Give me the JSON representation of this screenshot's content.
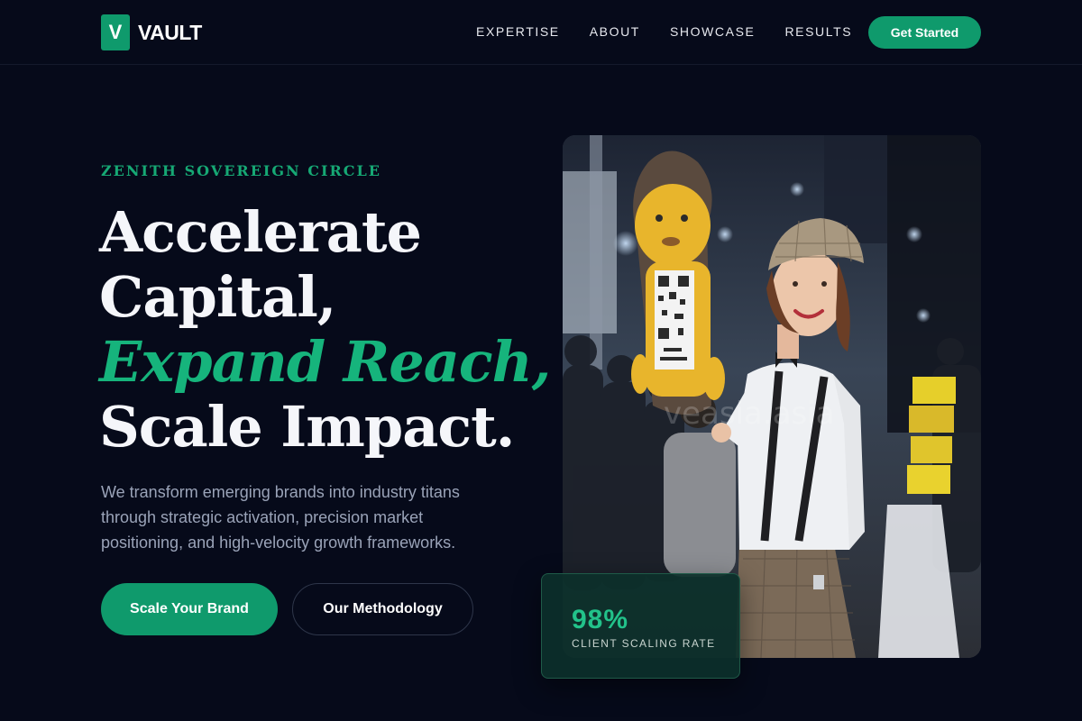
{
  "brand": {
    "logo_letter": "V",
    "name": "VAULT",
    "accent_color": "#0f9a6c",
    "background_color": "#060a1a"
  },
  "nav": {
    "items": [
      {
        "label": "EXPERTISE"
      },
      {
        "label": "ABOUT"
      },
      {
        "label": "SHOWCASE"
      },
      {
        "label": "RESULTS"
      }
    ],
    "cta_label": "Get Started"
  },
  "hero": {
    "eyebrow": "ZENITH SOVEREIGN CIRCLE",
    "headline_lines": [
      "Accelerate",
      "Capital,",
      "Expand Reach,",
      "Scale Impact."
    ],
    "description": "We transform emerging brands into industry titans through strategic activation, precision market positioning, and high-velocity growth frameworks.",
    "primary_button": "Scale Your Brand",
    "secondary_button": "Our Methodology"
  },
  "image": {
    "subject": "woman-in-flat-cap-with-mascot-sign",
    "watermark": "veasia.asia"
  },
  "stat": {
    "value": "98%",
    "label": "CLIENT SCALING RATE"
  }
}
